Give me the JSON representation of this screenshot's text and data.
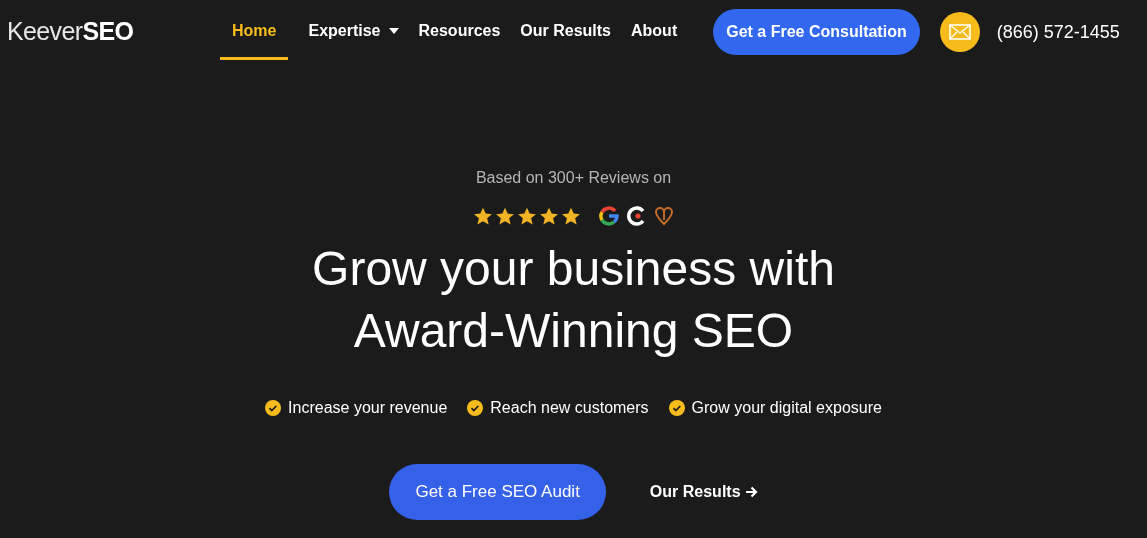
{
  "logo": "Keever**SEO**",
  "nav": [
    {
      "label": "Home",
      "selected": true,
      "kind": "link"
    },
    {
      "label": "Expertise",
      "selected": false,
      "kind": "dropdown"
    },
    {
      "label": "Resources",
      "selected": false,
      "kind": "link"
    },
    {
      "label": "Our Results",
      "selected": false,
      "kind": "link"
    },
    {
      "label": "About",
      "selected": false,
      "kind": "link"
    }
  ],
  "consultation_button": "Get a Free Consultation",
  "phone": "(866) 572-1455",
  "hero": {
    "reviews_caption": "Based on 300+ Reviews on",
    "stars": 5,
    "headline": [
      "Grow your business with",
      "Award-Winning SEO"
    ],
    "benefits": [
      "Increase your revenue",
      "Reach new customers",
      "Grow your digital exposure"
    ],
    "primary_button": "Get a Free SEO Audit",
    "secondary_link": "Our Results"
  }
}
